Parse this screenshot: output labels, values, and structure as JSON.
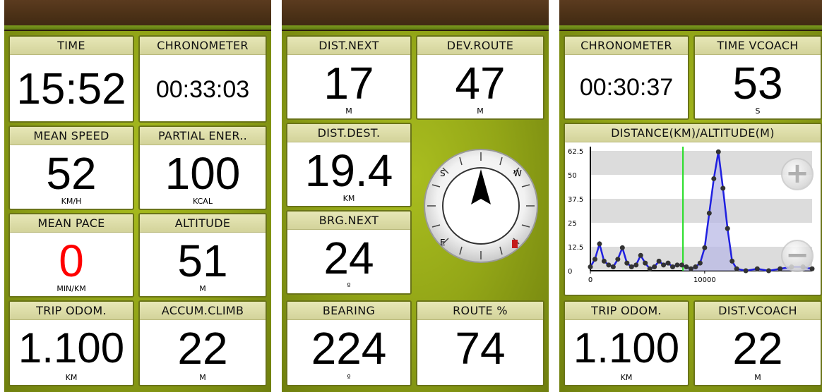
{
  "panel1": {
    "tiles": [
      {
        "label": "TIME",
        "value": "15:52",
        "unit": ""
      },
      {
        "label": "CHRONOMETER",
        "value": "00:33:03",
        "unit": ""
      },
      {
        "label": "MEAN SPEED",
        "value": "52",
        "unit": "KM/H"
      },
      {
        "label": "PARTIAL ENER..",
        "value": "100",
        "unit": "KCAL"
      },
      {
        "label": "MEAN PACE",
        "value": "0",
        "unit": "MIN/KM",
        "color": "#ff0000"
      },
      {
        "label": "ALTITUDE",
        "value": "51",
        "unit": "M"
      },
      {
        "label": "TRIP ODOM.",
        "value": "1.100",
        "unit": "KM"
      },
      {
        "label": "ACCUM.CLIMB",
        "value": "22",
        "unit": "M"
      }
    ]
  },
  "panel2": {
    "tiles": [
      {
        "label": "DIST.NEXT",
        "value": "17",
        "unit": "M"
      },
      {
        "label": "DEV.ROUTE",
        "value": "47",
        "unit": "M"
      },
      {
        "label": "DIST.DEST.",
        "value": "19.4",
        "unit": "KM"
      },
      {
        "label": "BRG.NEXT",
        "value": "24",
        "unit": "º"
      },
      {
        "label": "BEARING",
        "value": "224",
        "unit": "º"
      },
      {
        "label": "ROUTE %",
        "value": "74",
        "unit": ""
      }
    ],
    "compass": {
      "labels": [
        "S",
        "W",
        "E"
      ],
      "needle_icon": "navigation-arrow-icon"
    }
  },
  "panel3": {
    "tiles": [
      {
        "label": "CHRONOMETER",
        "value": "00:30:37",
        "unit": ""
      },
      {
        "label": "TIME VCOACH",
        "value": "53",
        "unit": "S"
      },
      {
        "label": "TRIP ODOM.",
        "value": "1.100",
        "unit": "KM"
      },
      {
        "label": "DIST.VCOACH",
        "value": "22",
        "unit": "M"
      }
    ],
    "chart_title": "DISTANCE(KM)/ALTITUDE(M)",
    "zoom_in_label": "+",
    "zoom_out_label": "−"
  },
  "chart_data": {
    "type": "line",
    "title": "DISTANCE(KM)/ALTITUDE(M)",
    "y_ticks": [
      "62.5",
      "50",
      "37.5",
      "25",
      "12.5",
      "0"
    ],
    "x_ticks": [
      "0",
      "10000"
    ],
    "ylim": [
      0,
      62.5
    ],
    "xlim": [
      0,
      19400
    ],
    "current_position_x": 8100,
    "series": [
      {
        "x": [
          0,
          400,
          800,
          1200,
          1600,
          2000,
          2400,
          2800,
          3200,
          3600,
          4000,
          4400,
          4800,
          5200,
          5600,
          6000,
          6400,
          6800,
          7200,
          7600,
          8000,
          8400,
          8800,
          9200,
          9600,
          10000,
          10400,
          10800,
          11200,
          11600,
          12000,
          12400,
          12800,
          13600,
          14600,
          15600,
          16600,
          17600,
          18600,
          19400
        ],
        "y": [
          2,
          6,
          14,
          5,
          3,
          2,
          6,
          12,
          4,
          2,
          3,
          8,
          4,
          1,
          2,
          5,
          3,
          4,
          2,
          3,
          3,
          2,
          1,
          2,
          4,
          12,
          30,
          48,
          62,
          43,
          22,
          5,
          1,
          0,
          1,
          0,
          1,
          2,
          2,
          1
        ]
      }
    ]
  }
}
